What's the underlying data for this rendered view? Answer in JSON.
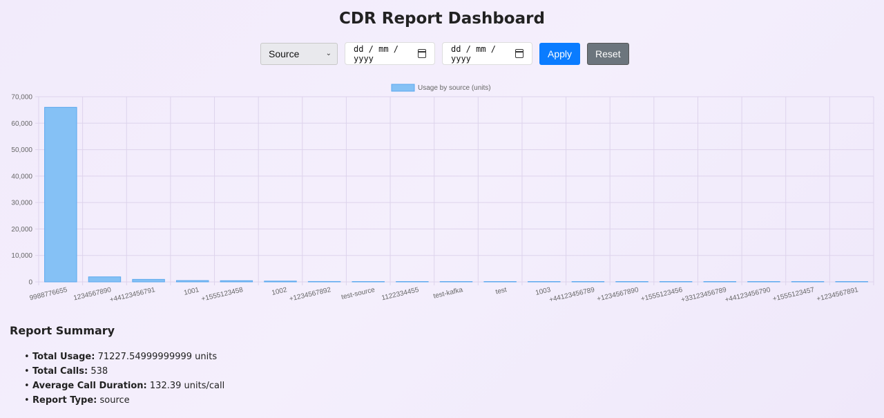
{
  "header": {
    "title": "CDR Report Dashboard"
  },
  "controls": {
    "report_select": "Source",
    "start_date": "dd / mm / yyyy",
    "end_date": "dd / mm / yyyy",
    "apply_label": "Apply",
    "reset_label": "Reset",
    "apply_color": "#0a7cff",
    "reset_color": "#6c757d"
  },
  "chart_data": {
    "type": "bar",
    "legend": "Usage by source (units)",
    "legend_position": "top-center",
    "grid": true,
    "bar_color": "#85c1f5",
    "bar_border": "#5aa8ee",
    "ylim": [
      0,
      70000
    ],
    "yticks": [
      "0",
      "10,000",
      "20,000",
      "30,000",
      "40,000",
      "50,000",
      "60,000",
      "70,000"
    ],
    "categories": [
      "9988776655",
      "1234567890",
      "+44123456791",
      "1001",
      "+1555123458",
      "1002",
      "+1234567892",
      "test-source",
      "1122334455",
      "test-kafka",
      "test",
      "1003",
      "+44123456789",
      "+1234567890",
      "+1555123456",
      "+33123456789",
      "+44123456790",
      "+1555123457",
      "+1234567891"
    ],
    "values": [
      66000,
      1900,
      950,
      500,
      450,
      300,
      150,
      80,
      40,
      30,
      20,
      15,
      12,
      10,
      8,
      6,
      5,
      4,
      3
    ]
  },
  "summary": {
    "title": "Report Summary",
    "items": [
      {
        "label": "Total Usage:",
        "value": "71227.54999999999 units"
      },
      {
        "label": "Total Calls:",
        "value": "538"
      },
      {
        "label": "Average Call Duration:",
        "value": "132.39 units/call"
      },
      {
        "label": "Report Type:",
        "value": "source"
      }
    ]
  }
}
